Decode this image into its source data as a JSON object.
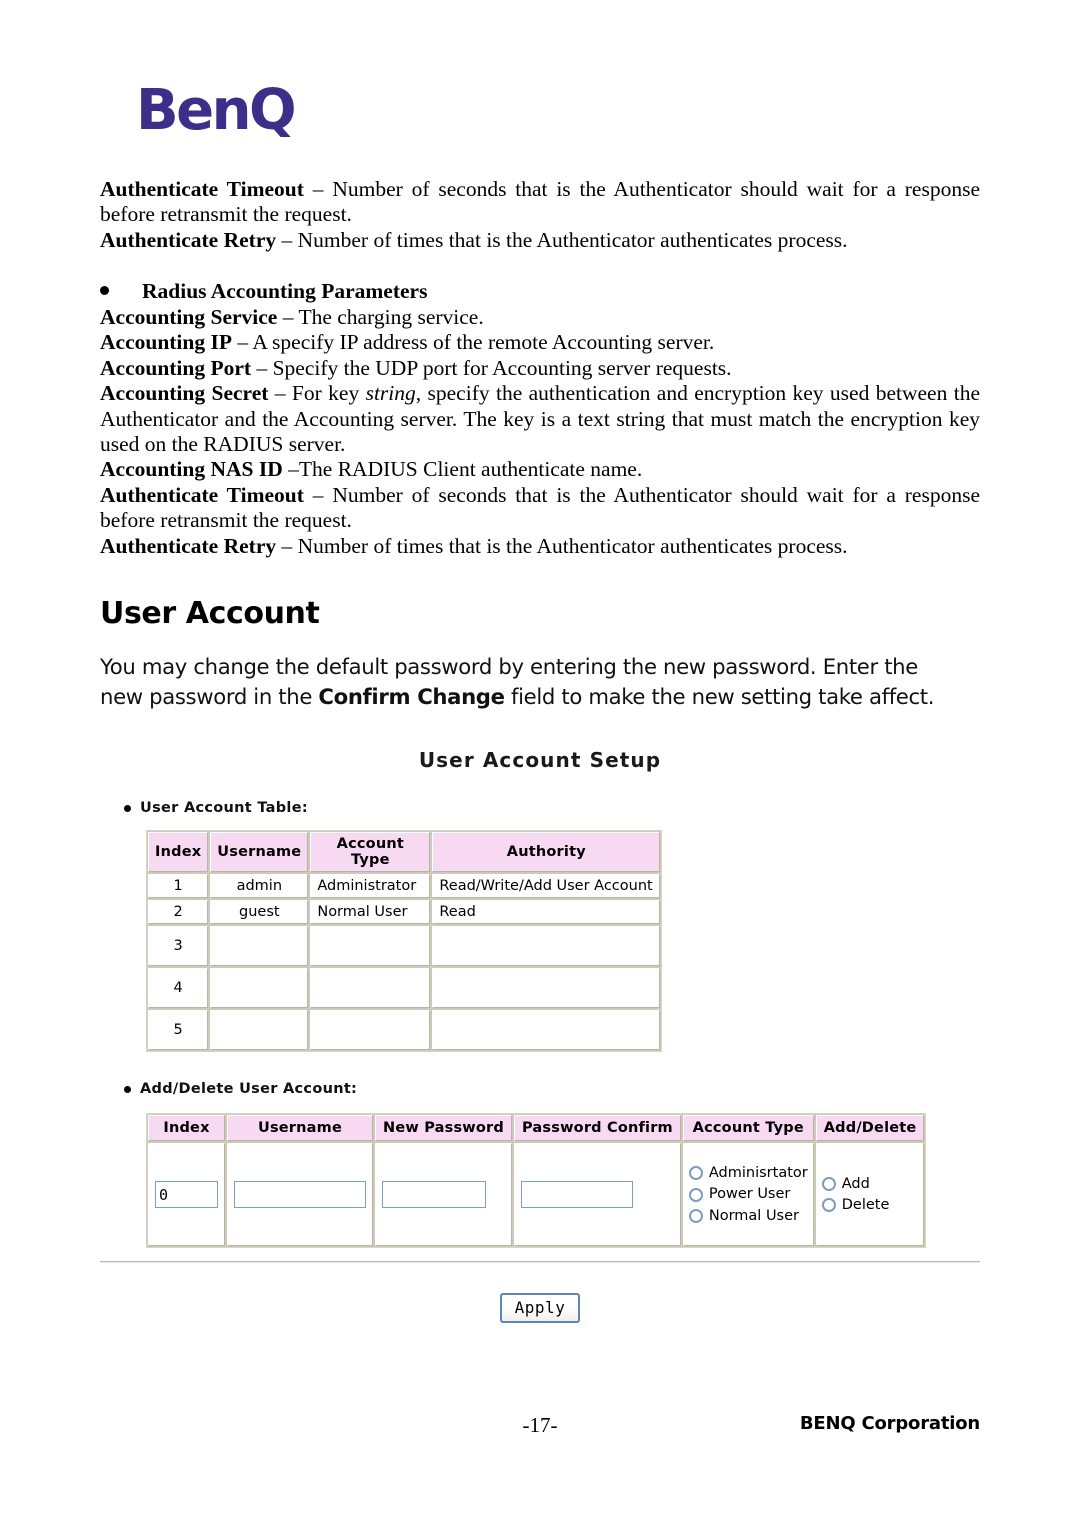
{
  "logo": {
    "text": "BenQ",
    "color": "#3b2f8a"
  },
  "body_text": {
    "para1": {
      "term": "Authenticate Timeout",
      "text": " – Number of seconds that is the Authenticator should wait for a response before retransmit the request."
    },
    "para2": {
      "term": "Authenticate Retry",
      "text": " – Number of times that is the Authenticator authenticates process."
    },
    "bullet_heading": "Radius Accounting Parameters",
    "para3": {
      "term": "Accounting Service",
      "text": " – The charging service."
    },
    "para4": {
      "term": "Accounting IP",
      "text": " – A specify IP address of the remote Accounting server."
    },
    "para5": {
      "term": "Accounting Port",
      "text": " – Specify the UDP port for Accounting server requests."
    },
    "para6": {
      "term": "Accounting Secret",
      "text_before": " – For key ",
      "italic": "string",
      "text_after": ", specify the authentication and encryption key used between the Authenticator and the Accounting server. The key is a text string that must match the encryption key used on the RADIUS server."
    },
    "para7": {
      "term": "Accounting NAS ID",
      "text": " –The RADIUS Client authenticate name."
    },
    "para8": {
      "term": "Authenticate Timeout",
      "text": " – Number of seconds that is the Authenticator should wait for a response before retransmit the request."
    },
    "para9": {
      "term": "Authenticate Retry",
      "text": " – Number of times that is the Authenticator authenticates process."
    }
  },
  "section": {
    "heading": "User Account",
    "intro_before": "You may change the default password by entering the new password.    Enter the new password in the ",
    "intro_bold": "Confirm Change",
    "intro_after": " field to make the new setting take affect."
  },
  "webui": {
    "title": "User Account Setup",
    "accent_pink": "#f7d9f2",
    "label_user_table": "User Account Table:",
    "label_add_delete": "Add/Delete User Account:",
    "user_account_table": {
      "headers": [
        "Index",
        "Username",
        "Account Type",
        "Authority"
      ],
      "rows": [
        {
          "index": "1",
          "username": "admin",
          "account_type": "Administrator",
          "authority": "Read/Write/Add User Account"
        },
        {
          "index": "2",
          "username": "guest",
          "account_type": "Normal User",
          "authority": "Read"
        },
        {
          "index": "3",
          "username": "",
          "account_type": "",
          "authority": ""
        },
        {
          "index": "4",
          "username": "",
          "account_type": "",
          "authority": ""
        },
        {
          "index": "5",
          "username": "",
          "account_type": "",
          "authority": ""
        }
      ]
    },
    "add_delete_table": {
      "headers": [
        "Index",
        "Username",
        "New Password",
        "Password Confirm",
        "Account Type",
        "Add/Delete"
      ],
      "index_value": "0",
      "username_value": "",
      "new_password_value": "",
      "password_confirm_value": "",
      "account_type_options": [
        "Adminisrtator",
        "Power User",
        "Normal User"
      ],
      "add_delete_options": [
        "Add",
        "Delete"
      ]
    },
    "apply_label": "Apply"
  },
  "footer": {
    "page_number": "-17-",
    "corporation": "BENQ Corporation"
  }
}
